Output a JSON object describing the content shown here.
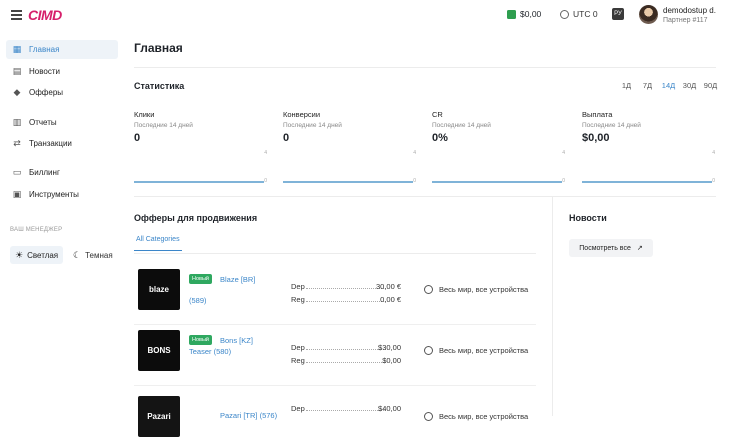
{
  "header": {
    "logo": "CIMD",
    "balance": "$0,00",
    "timezone": "UTC 0",
    "language": "РУ",
    "user_name": "demodostup d.",
    "user_role": "Партнер #117"
  },
  "sidebar": {
    "items": [
      {
        "label": "Главная",
        "icon": "grid-icon"
      },
      {
        "label": "Новости",
        "icon": "news-icon"
      },
      {
        "label": "Офферы",
        "icon": "tag-icon"
      },
      {
        "label": "Отчеты",
        "icon": "bar-chart-icon"
      },
      {
        "label": "Транзакции",
        "icon": "transactions-icon"
      },
      {
        "label": "Биллинг",
        "icon": "card-icon"
      },
      {
        "label": "Инструменты",
        "icon": "tools-icon"
      }
    ],
    "manager_label": "ВАШ МЕНЕДЖЕР",
    "theme_light": "Светлая",
    "theme_dark": "Темная"
  },
  "main": {
    "title": "Главная",
    "stats_title": "Статистика",
    "periods": [
      "1Д",
      "7Д",
      "14Д",
      "30Д",
      "90Д"
    ],
    "active_period": "14Д",
    "stats": [
      {
        "label": "Клики",
        "sub": "Последние 14 дней",
        "value": "0"
      },
      {
        "label": "Конверсии",
        "sub": "Последние 14 дней",
        "value": "0"
      },
      {
        "label": "CR",
        "sub": "Последние 14 дней",
        "value": "0%"
      },
      {
        "label": "Выплата",
        "sub": "Последние 14 дней",
        "value": "$0,00"
      }
    ],
    "sparkline_max_tick": "4",
    "sparkline_min_tick": "0",
    "offers_title": "Офферы для продвижения",
    "offers_tab": "All Categories",
    "offers": [
      {
        "thumb": "blaze",
        "badge": "Новый",
        "name": "Blaze [BR]",
        "id": "(589)",
        "dep_label": "Dep",
        "dep": "30,00 €",
        "reg_label": "Reg",
        "reg": "0,00 €",
        "geo": "Весь мир, все устройства"
      },
      {
        "thumb": "BONS",
        "badge": "Новый",
        "name": "Bons [KZ]",
        "id": "Teaser (580)",
        "dep_label": "Dep",
        "dep": "$30,00",
        "reg_label": "Reg",
        "reg": "$0,00",
        "geo": "Весь мир, все устройства"
      },
      {
        "thumb": "Pazari",
        "badge": "",
        "name": "Pazari [TR] (576)",
        "id": "",
        "dep_label": "Dep",
        "dep": "$40,00",
        "reg_label": "",
        "reg": "",
        "geo": "Весь мир, все устройства"
      }
    ],
    "news_title": "Новости",
    "news_button": "Посмотреть все"
  }
}
